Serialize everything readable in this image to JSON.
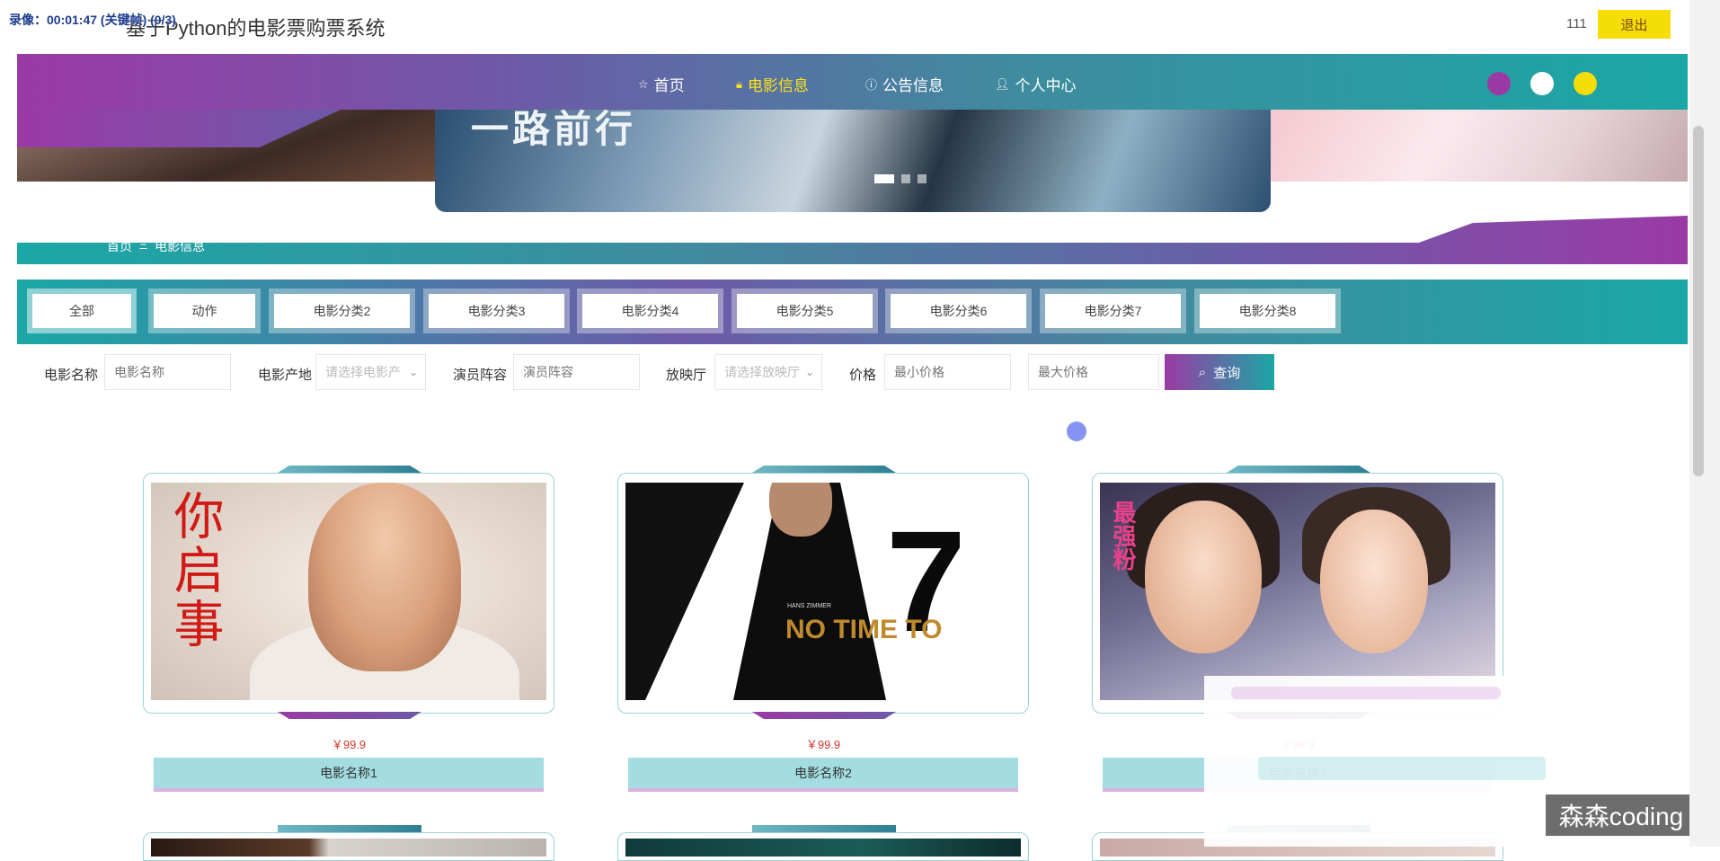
{
  "header": {
    "recording_overlay": "录像：00:01:47 (关键帧) (0/3)",
    "site_title": "基于Python的电影票购票系统",
    "username": "111",
    "logout_label": "退出"
  },
  "nav": {
    "items": [
      {
        "label": "首页",
        "icon": "star-icon"
      },
      {
        "label": "电影信息",
        "icon": "lock-icon",
        "active": true
      },
      {
        "label": "公告信息",
        "icon": "info-icon"
      },
      {
        "label": "个人中心",
        "icon": "user-icon"
      }
    ],
    "theme_dots": [
      "#9b3aa5",
      "#ffffff",
      "#f5dd0a"
    ]
  },
  "banner": {
    "partial_title": "一路前行",
    "carousel_count": 3,
    "carousel_active": 0
  },
  "breadcrumb": {
    "home": "首页",
    "separator": "Ξ",
    "current": "电影信息"
  },
  "categories": [
    "全部",
    "动作",
    "电影分类2",
    "电影分类3",
    "电影分类4",
    "电影分类5",
    "电影分类6",
    "电影分类7",
    "电影分类8"
  ],
  "filters": {
    "name_label": "电影名称",
    "name_placeholder": "电影名称",
    "origin_label": "电影产地",
    "origin_placeholder": "请选择电影产",
    "cast_label": "演员阵容",
    "cast_placeholder": "演员阵容",
    "hall_label": "放映厅",
    "hall_placeholder": "请选择放映厅",
    "price_label": "价格",
    "price_min_placeholder": "最小价格",
    "price_max_placeholder": "最大价格",
    "search_label": "查询"
  },
  "movies": [
    {
      "name": "电影名称1",
      "price": "￥99.9",
      "poster_text": "你启事"
    },
    {
      "name": "电影名称2",
      "price": "￥99.9",
      "poster_text": "NO TIME TO",
      "poster_sub": "HANS ZIMMER"
    },
    {
      "name": "电影名称3",
      "price": "￥99.9",
      "poster_text": "最强粉"
    }
  ],
  "watermark": "森森coding",
  "colors": {
    "purple": "#9b3aa5",
    "teal": "#1aa7a5",
    "yellow": "#f5dd0a",
    "price_red": "#d9362b",
    "name_bar": "#a3dde1"
  }
}
